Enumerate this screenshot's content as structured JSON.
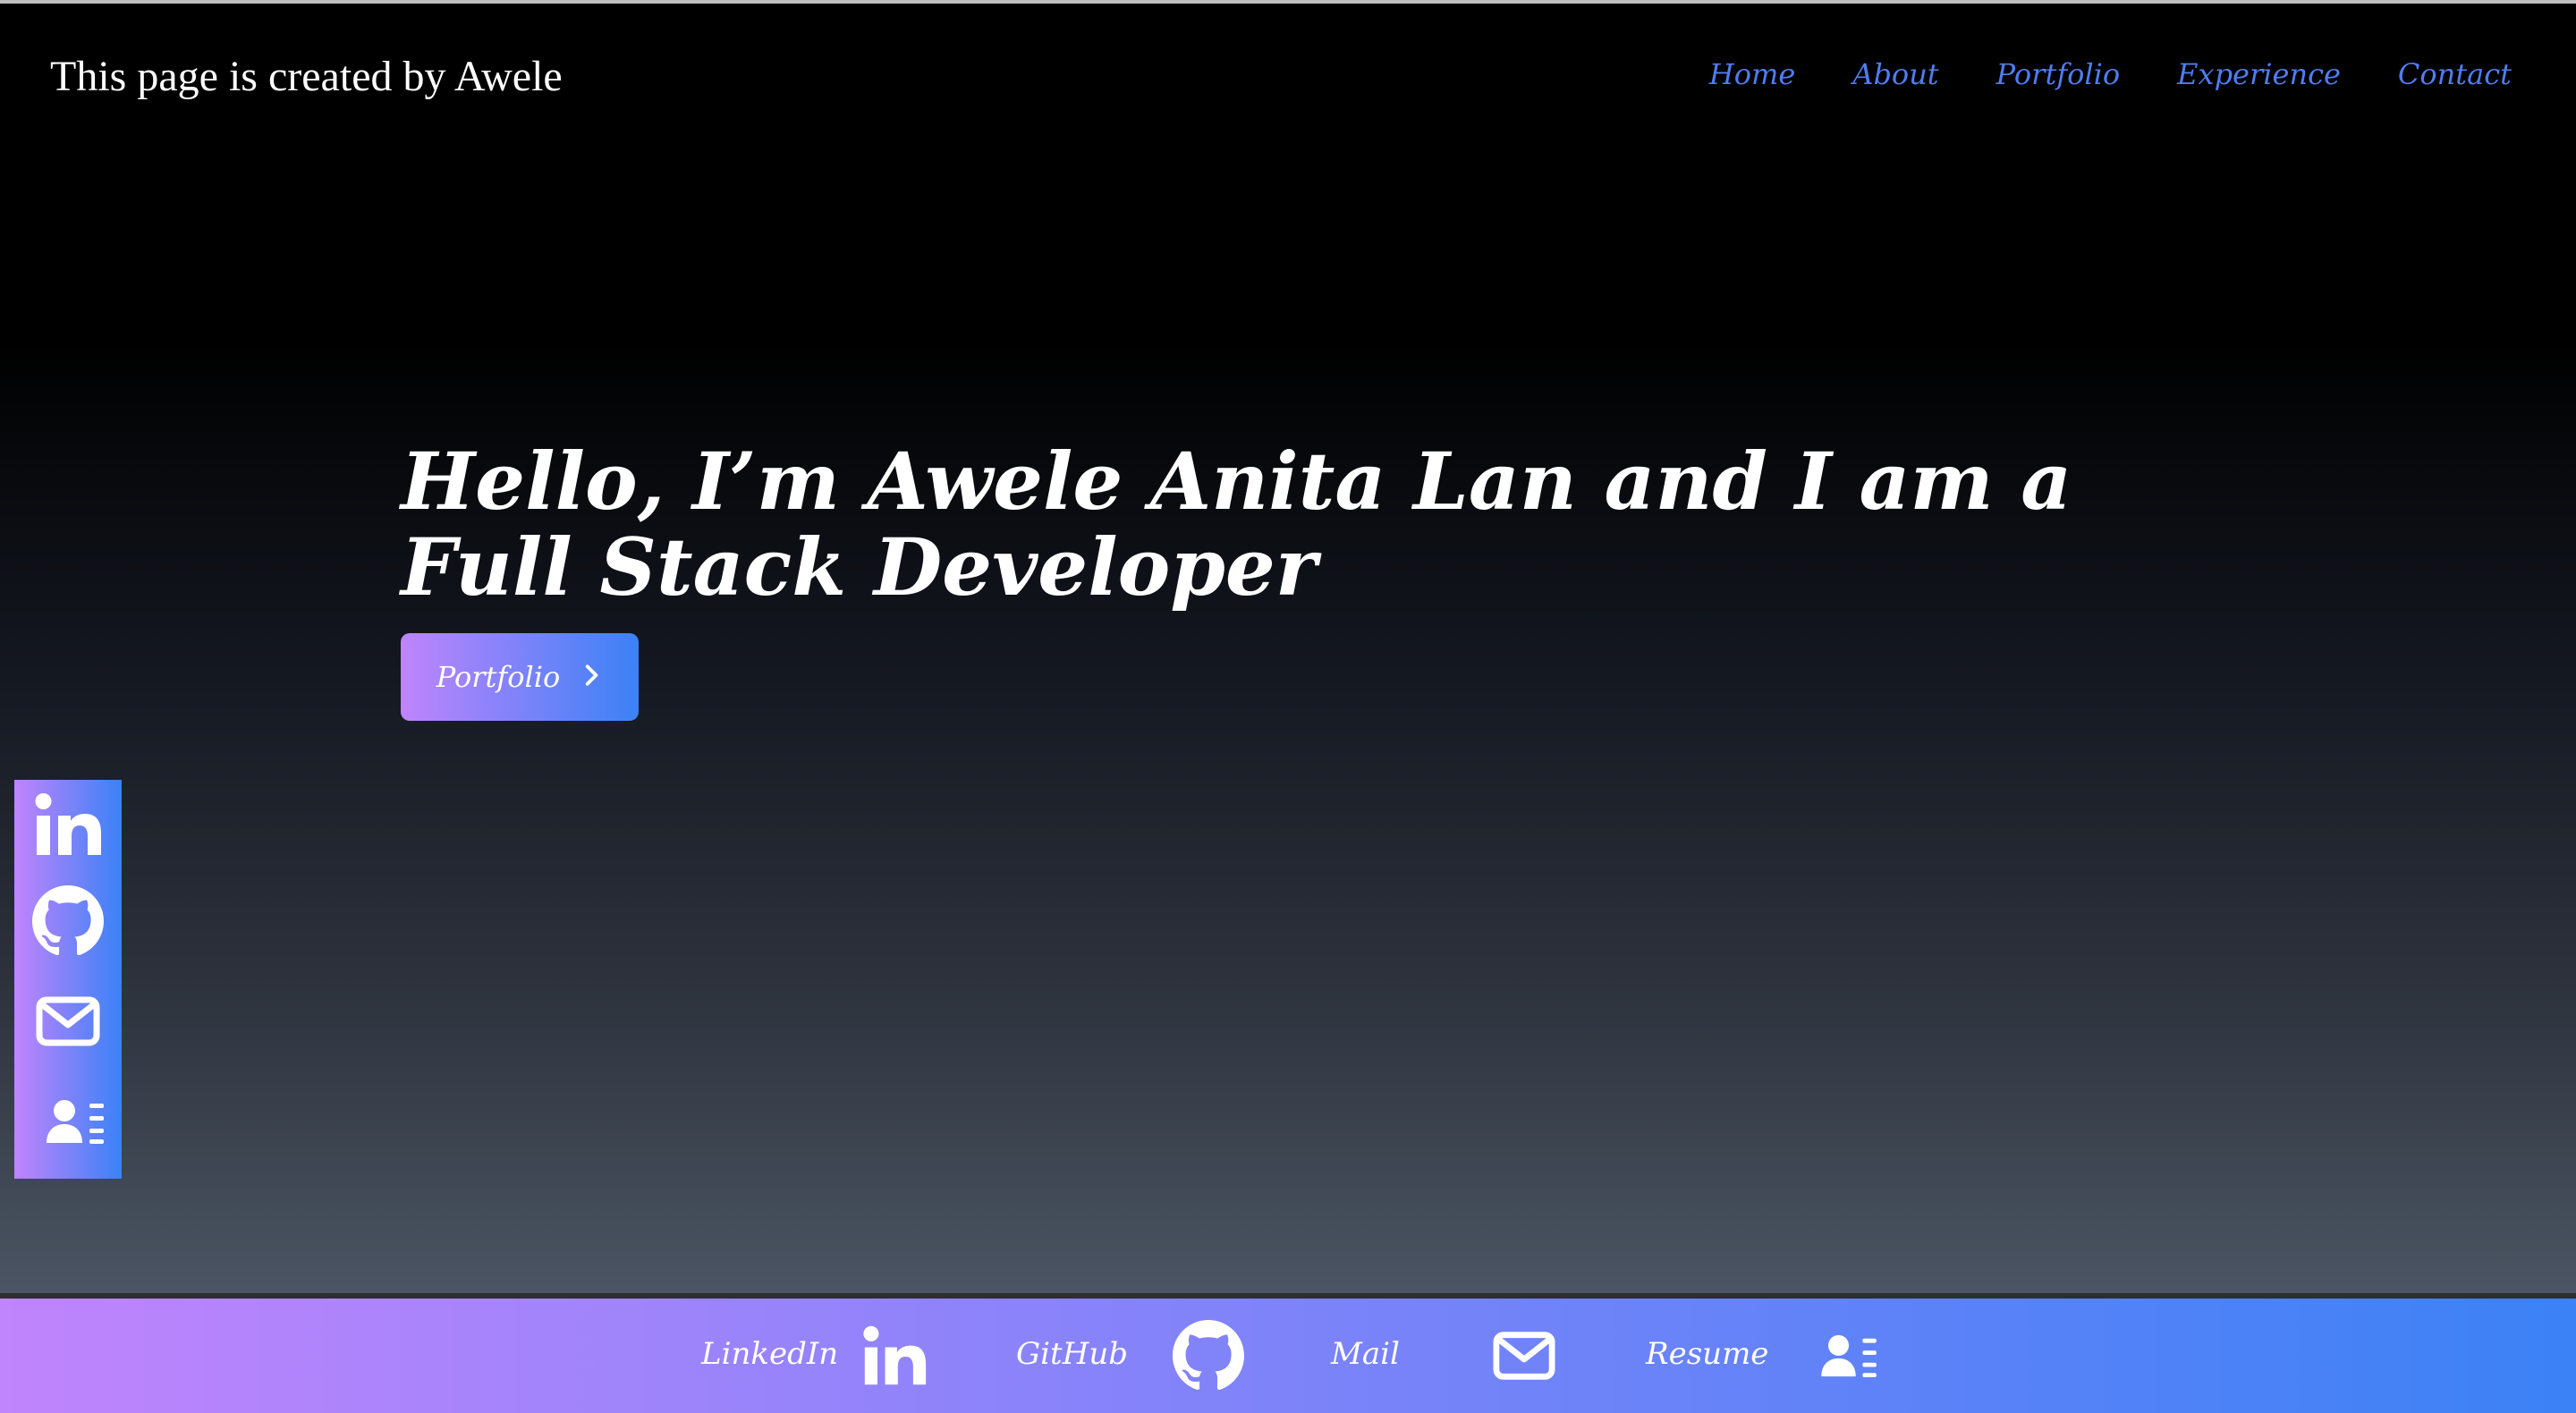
{
  "header": {
    "brand": "This page is created by Awele",
    "nav": [
      "Home",
      "About",
      "Portfolio",
      "Experience",
      "Contact"
    ]
  },
  "hero": {
    "title": "Hello, I’m Awele Anita Lan and I am a Full Stack Developer",
    "button_label": "Portfolio"
  },
  "side_bar": {
    "icons": [
      "linkedin-icon",
      "github-icon",
      "mail-icon",
      "resume-icon"
    ]
  },
  "footer": {
    "links": [
      {
        "label": "LinkedIn",
        "icon": "linkedin-icon"
      },
      {
        "label": "GitHub",
        "icon": "github-icon"
      },
      {
        "label": "Mail",
        "icon": "mail-icon"
      },
      {
        "label": "Resume",
        "icon": "resume-icon"
      }
    ]
  },
  "colors": {
    "nav_link": "#4f7df0",
    "gradient_start": "#c084fc",
    "gradient_end": "#3b82f6"
  }
}
